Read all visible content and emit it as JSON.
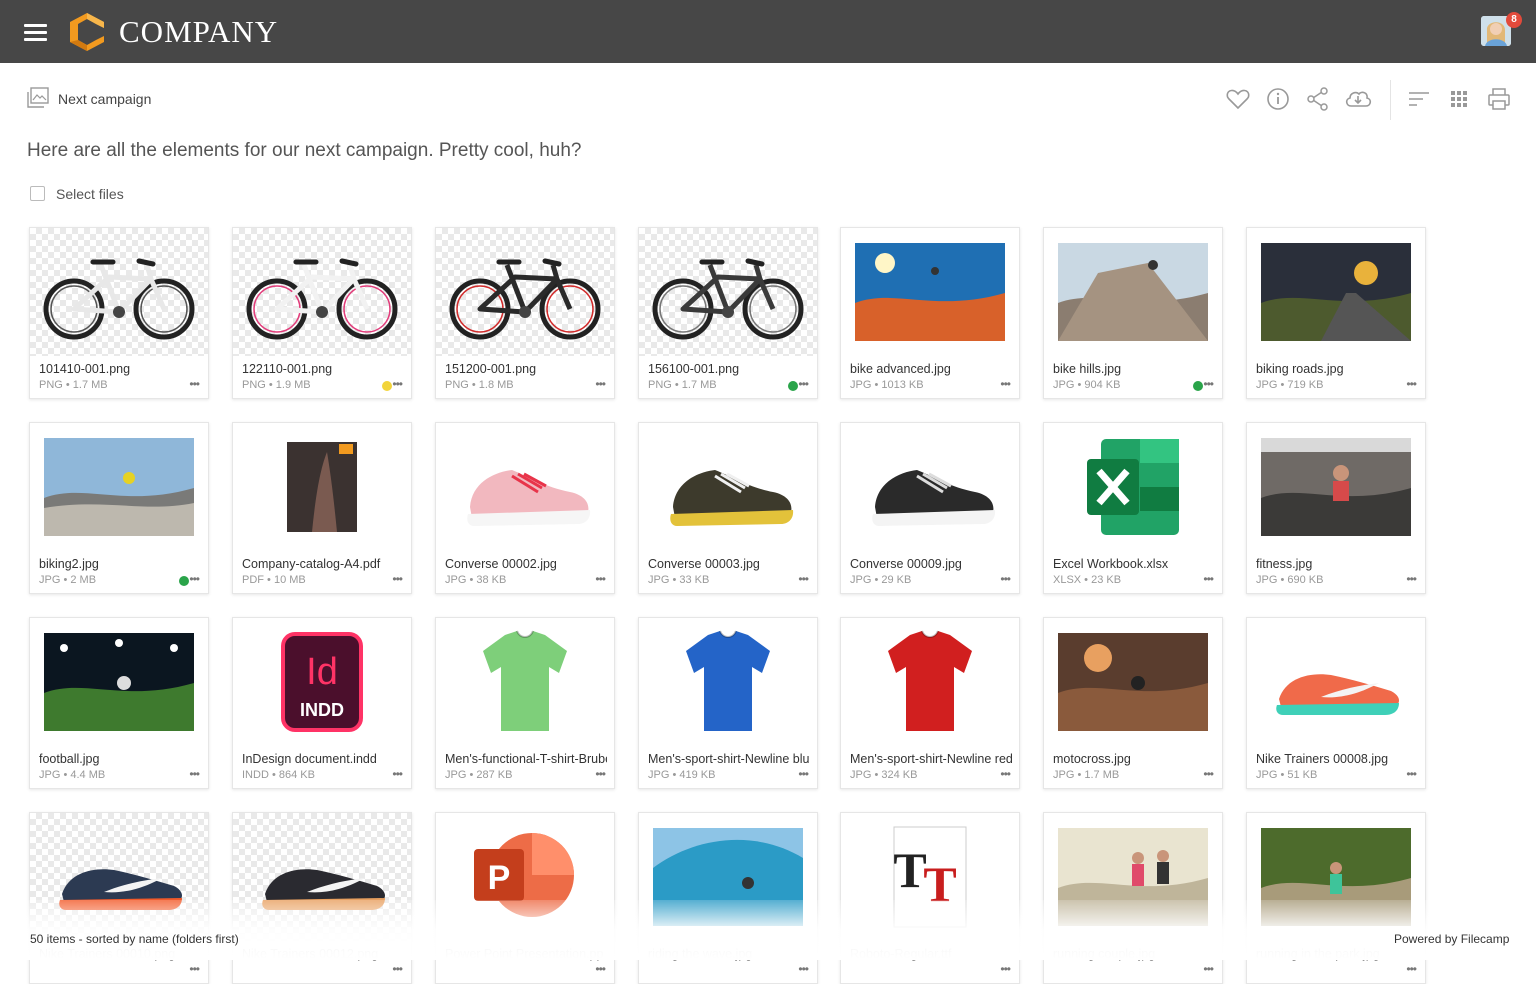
{
  "header": {
    "brand": "COMPANY",
    "menu_icon": "hamburger-icon",
    "notification_count": "8",
    "colors": {
      "bar": "#474747",
      "logo_orange": "#f29a1f",
      "badge": "#e24a3b"
    }
  },
  "breadcrumb": {
    "icon": "gallery-icon",
    "label": "Next campaign"
  },
  "toolbar": [
    "heart-icon",
    "info-icon",
    "share-icon",
    "cloud-download-icon",
    "sort-icon",
    "grid-view-icon",
    "print-icon"
  ],
  "description": "Here are all the elements for our next campaign. Pretty cool, huh?",
  "select_label": "Select files",
  "tag_colors": {
    "yellow": "#f2d43b",
    "green": "#2aa44a"
  },
  "files": [
    {
      "name": "101410-001.png",
      "meta": "PNG • 1.7 MB",
      "thumb": "bike-white"
    },
    {
      "name": "122110-001.png",
      "meta": "PNG • 1.9 MB",
      "thumb": "bike-pink",
      "tag": "yellow"
    },
    {
      "name": "151200-001.png",
      "meta": "PNG • 1.8 MB",
      "thumb": "bike-red"
    },
    {
      "name": "156100-001.png",
      "meta": "PNG • 1.7 MB",
      "thumb": "bike-black",
      "tag": "green"
    },
    {
      "name": "bike advanced.jpg",
      "meta": "JPG • 1013 KB",
      "thumb": "photo-desert"
    },
    {
      "name": "bike hills.jpg",
      "meta": "JPG • 904 KB",
      "thumb": "photo-rock",
      "tag": "green"
    },
    {
      "name": "biking roads.jpg",
      "meta": "JPG • 719 KB",
      "thumb": "photo-road"
    },
    {
      "name": "biking2.jpg",
      "meta": "JPG • 2 MB",
      "thumb": "photo-coast",
      "tag": "green"
    },
    {
      "name": "Company-catalog-A4.pdf",
      "meta": "PDF • 10 MB",
      "thumb": "pdf-cover"
    },
    {
      "name": "Converse 00002.jpg",
      "meta": "JPG • 38 KB",
      "thumb": "shoe-pink"
    },
    {
      "name": "Converse 00003.jpg",
      "meta": "JPG • 33 KB",
      "thumb": "shoe-brown"
    },
    {
      "name": "Converse 00009.jpg",
      "meta": "JPG • 29 KB",
      "thumb": "shoe-black"
    },
    {
      "name": "Excel Workbook.xlsx",
      "meta": "XLSX • 23 KB",
      "thumb": "excel-icon"
    },
    {
      "name": "fitness.jpg",
      "meta": "JPG • 690 KB",
      "thumb": "photo-gym"
    },
    {
      "name": "football.jpg",
      "meta": "JPG • 4.4 MB",
      "thumb": "photo-stadium"
    },
    {
      "name": "InDesign document.indd",
      "meta": "INDD • 864 KB",
      "thumb": "indesign-icon"
    },
    {
      "name": "Men's-functional-T-shirt-Brube",
      "meta": "JPG • 287 KB",
      "thumb": "shirt-green"
    },
    {
      "name": "Men's-sport-shirt-Newline blu",
      "meta": "JPG • 419 KB",
      "thumb": "shirt-blue"
    },
    {
      "name": "Men's-sport-shirt-Newline red",
      "meta": "JPG • 324 KB",
      "thumb": "shirt-red"
    },
    {
      "name": "motocross.jpg",
      "meta": "JPG • 1.7 MB",
      "thumb": "photo-moto"
    },
    {
      "name": "Nike Trainers 00008.jpg",
      "meta": "JPG • 51 KB",
      "thumb": "shoe-nike-red"
    },
    {
      "name": "Nike Trainers 00010.png",
      "meta": "",
      "thumb": "shoe-nike-navy"
    },
    {
      "name": "Nike Trainers 00012.png",
      "meta": "",
      "thumb": "shoe-nike-dark"
    },
    {
      "name": "Power Point Presentation.pp",
      "meta": "",
      "thumb": "powerpoint-icon"
    },
    {
      "name": "riding the wave.jpg",
      "meta": "",
      "thumb": "photo-wave"
    },
    {
      "name": "Roboto-Regular.ttf",
      "meta": "",
      "thumb": "font-icon"
    },
    {
      "name": "running couple.jpg",
      "meta": "",
      "thumb": "photo-runners"
    },
    {
      "name": "running in the park.jpg",
      "meta": "",
      "thumb": "photo-park"
    }
  ],
  "status": {
    "left": "50 items - sorted by name (folders first)",
    "right": "Powered by Filecamp"
  }
}
